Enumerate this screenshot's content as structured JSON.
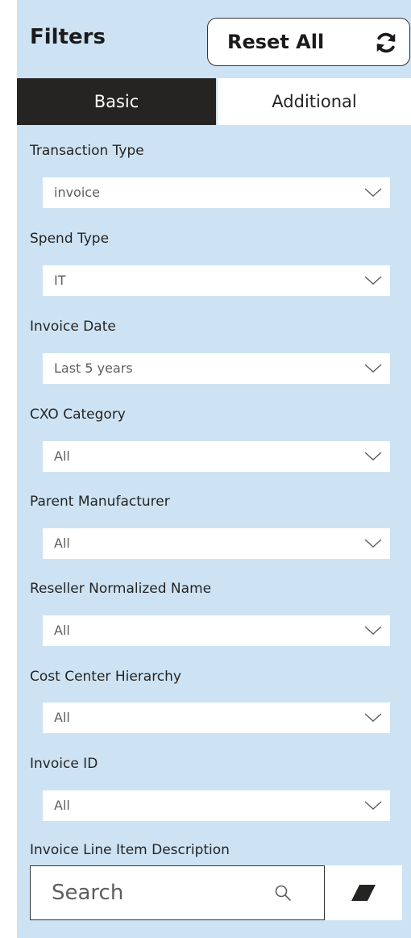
{
  "header": {
    "title": "Filters",
    "reset_label": "Reset All",
    "reset_icon": "refresh-icon"
  },
  "tabs": [
    {
      "label": "Basic",
      "active": true
    },
    {
      "label": "Additional",
      "active": false
    }
  ],
  "filters": [
    {
      "label": "Transaction Type",
      "value": "invoice"
    },
    {
      "label": "Spend Type",
      "value": "IT"
    },
    {
      "label": "Invoice Date",
      "value": "Last 5 years"
    },
    {
      "label": "CXO Category",
      "value": "All"
    },
    {
      "label": "Parent Manufacturer",
      "value": "All"
    },
    {
      "label": "Reseller Normalized Name",
      "value": "All"
    },
    {
      "label": "Cost Center Hierarchy",
      "value": "All"
    },
    {
      "label": "Invoice ID",
      "value": "All"
    }
  ],
  "search": {
    "label": "Invoice Line Item Description",
    "placeholder": "Search",
    "icon": "search-icon",
    "clear_icon": "eraser-icon"
  },
  "colors": {
    "panel_bg": "#cde3f4",
    "active_tab_bg": "#252423",
    "text": "#252423",
    "muted_text": "#605e5c"
  }
}
